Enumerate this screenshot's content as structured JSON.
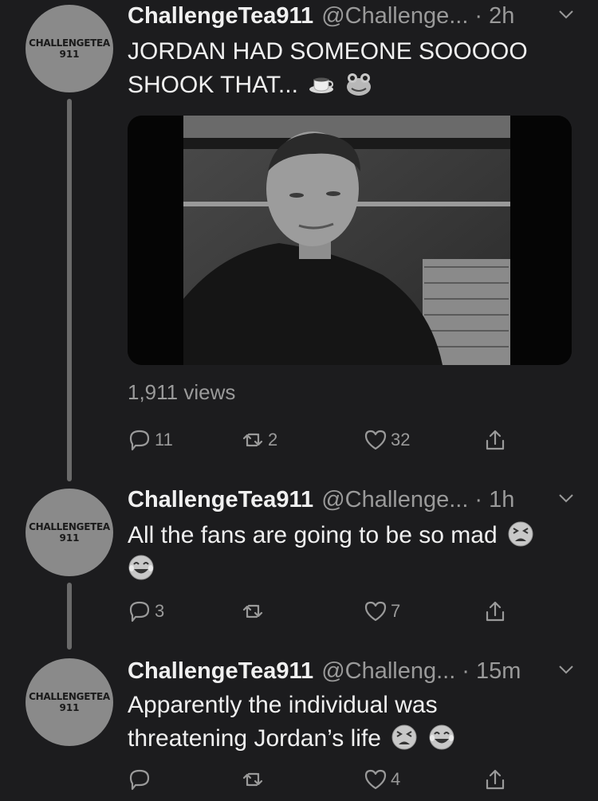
{
  "tweets": [
    {
      "avatar": {
        "line1": "CHALLENGETEA",
        "line2": "911"
      },
      "name": "ChallengeTea911",
      "handle": "@Challenge...",
      "time": "· 2h",
      "text": "JORDAN HAD SOMEONE SOOOOO SHOOK THAT...",
      "emojis": [
        "coffee-emoji",
        "frog-emoji"
      ],
      "views": "1,911 views",
      "reply_count": "11",
      "retweet_count": "2",
      "like_count": "32"
    },
    {
      "avatar": {
        "line1": "CHALLENGETEA",
        "line2": "911"
      },
      "name": "ChallengeTea911",
      "handle": "@Challenge...",
      "time": "· 1h",
      "text": "All the fans are going to be so mad",
      "emojis": [
        "tired-face-emoji",
        "tears-of-joy-emoji"
      ],
      "reply_count": "3",
      "retweet_count": "",
      "like_count": "7"
    },
    {
      "avatar": {
        "line1": "CHALLENGETEA",
        "line2": "911"
      },
      "name": "ChallengeTea911",
      "handle": "@Challeng...",
      "time": "· 15m",
      "text": "Apparently the individual was threatening Jordan’s life",
      "emojis": [
        "tired-face-emoji",
        "tears-of-joy-emoji"
      ],
      "reply_count": "",
      "retweet_count": "",
      "like_count": "4"
    }
  ],
  "colors": {
    "background": "#1c1c1e",
    "muted": "#9a9a9a",
    "avatar": "#8a8a8a"
  }
}
